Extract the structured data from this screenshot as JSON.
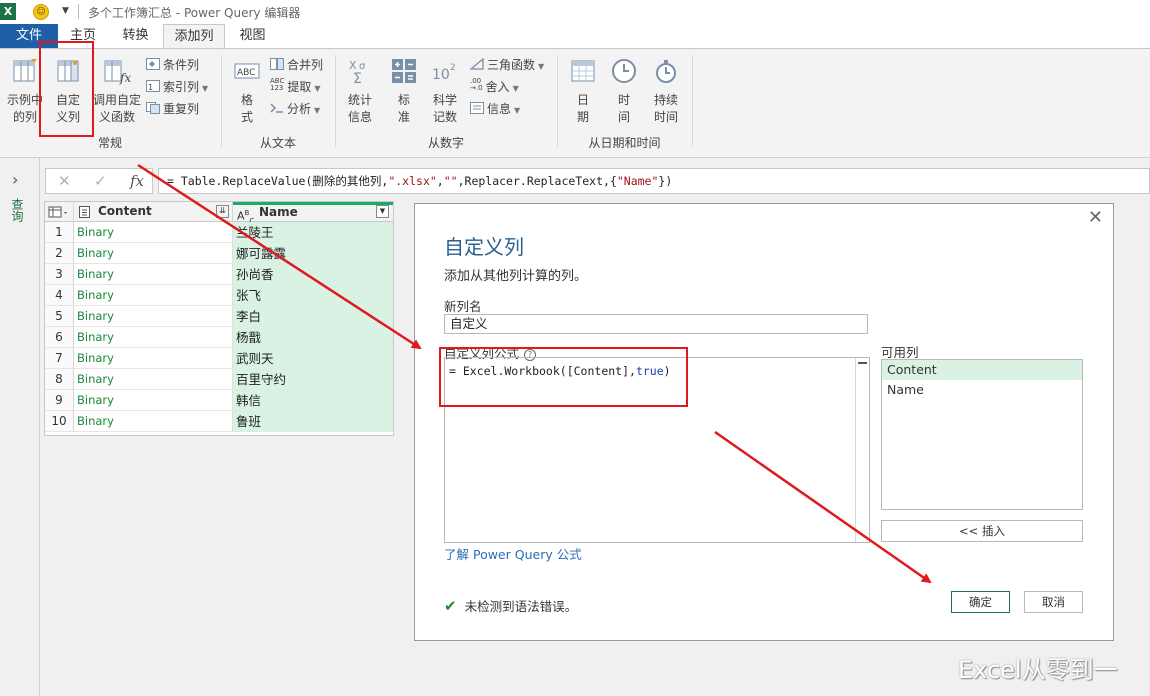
{
  "window": {
    "title": "多个工作簿汇总 - Power Query 编辑器",
    "app_logo": "X"
  },
  "tabs": {
    "file": "文件",
    "home": "主页",
    "transform": "转换",
    "add_column": "添加列",
    "view": "视图"
  },
  "ribbon": {
    "general": {
      "example_col": [
        "示例中",
        "的列"
      ],
      "custom_col": [
        "自定",
        "义列"
      ],
      "invoke_func": [
        "调用自定",
        "义函数"
      ],
      "conditional": "条件列",
      "index": "索引列",
      "duplicate": "重复列",
      "group_label": "常规"
    },
    "from_text": {
      "format": [
        "格",
        "式"
      ],
      "merge": "合并列",
      "extract": "提取",
      "parse": "分析",
      "group_label": "从文本"
    },
    "from_number": {
      "statistics": [
        "统计",
        "信息"
      ],
      "standard": [
        "标",
        "准"
      ],
      "scientific": [
        "科学",
        "记数"
      ],
      "trig": "三角函数",
      "rounding": "舍入",
      "info": "信息",
      "group_label": "从数字"
    },
    "from_datetime": {
      "date": [
        "日",
        "期"
      ],
      "time": [
        "时",
        "间"
      ],
      "duration": [
        "持续",
        "时间"
      ],
      "group_label": "从日期和时间"
    }
  },
  "formula_bar": {
    "fx": "fx",
    "prefix": "= Table.ReplaceValue(删除的其他列,",
    "arg1": "\".xlsx\"",
    "comma1": ",",
    "arg2": "\"\"",
    "mid": ",Replacer.ReplaceText,{",
    "arg3": "\"Name\"",
    "suffix": "})"
  },
  "left_nav": {
    "queries_label": "查询"
  },
  "grid": {
    "columns": [
      "Content",
      "Name"
    ],
    "rows": [
      {
        "n": "1",
        "content": "Binary",
        "name": "兰陵王"
      },
      {
        "n": "2",
        "content": "Binary",
        "name": "娜可露露"
      },
      {
        "n": "3",
        "content": "Binary",
        "name": "孙尚香"
      },
      {
        "n": "4",
        "content": "Binary",
        "name": "张飞"
      },
      {
        "n": "5",
        "content": "Binary",
        "name": "李白"
      },
      {
        "n": "6",
        "content": "Binary",
        "name": "杨戬"
      },
      {
        "n": "7",
        "content": "Binary",
        "name": "武则天"
      },
      {
        "n": "8",
        "content": "Binary",
        "name": "百里守约"
      },
      {
        "n": "9",
        "content": "Binary",
        "name": "韩信"
      },
      {
        "n": "10",
        "content": "Binary",
        "name": "鲁班"
      }
    ]
  },
  "dialog": {
    "title": "自定义列",
    "description": "添加从其他列计算的列。",
    "new_col_label": "新列名",
    "new_col_value": "自定义",
    "formula_label": "自定义列公式",
    "formula_prefix": "= Excel.Workbook([Content],",
    "formula_true": "true",
    "formula_suffix": ")",
    "available_label": "可用列",
    "available": [
      "Content",
      "Name"
    ],
    "insert_button": "<< 插入",
    "learn_link": "了解 Power Query 公式",
    "status": "未检测到语法错误。",
    "ok": "确定",
    "cancel": "取消"
  },
  "watermark": "Excel从零到一",
  "colors": {
    "accent_blue": "#1e5fa8",
    "excel_green": "#1e7145",
    "highlight_red": "#e0191f",
    "selected_green": "#d9f2e3"
  }
}
